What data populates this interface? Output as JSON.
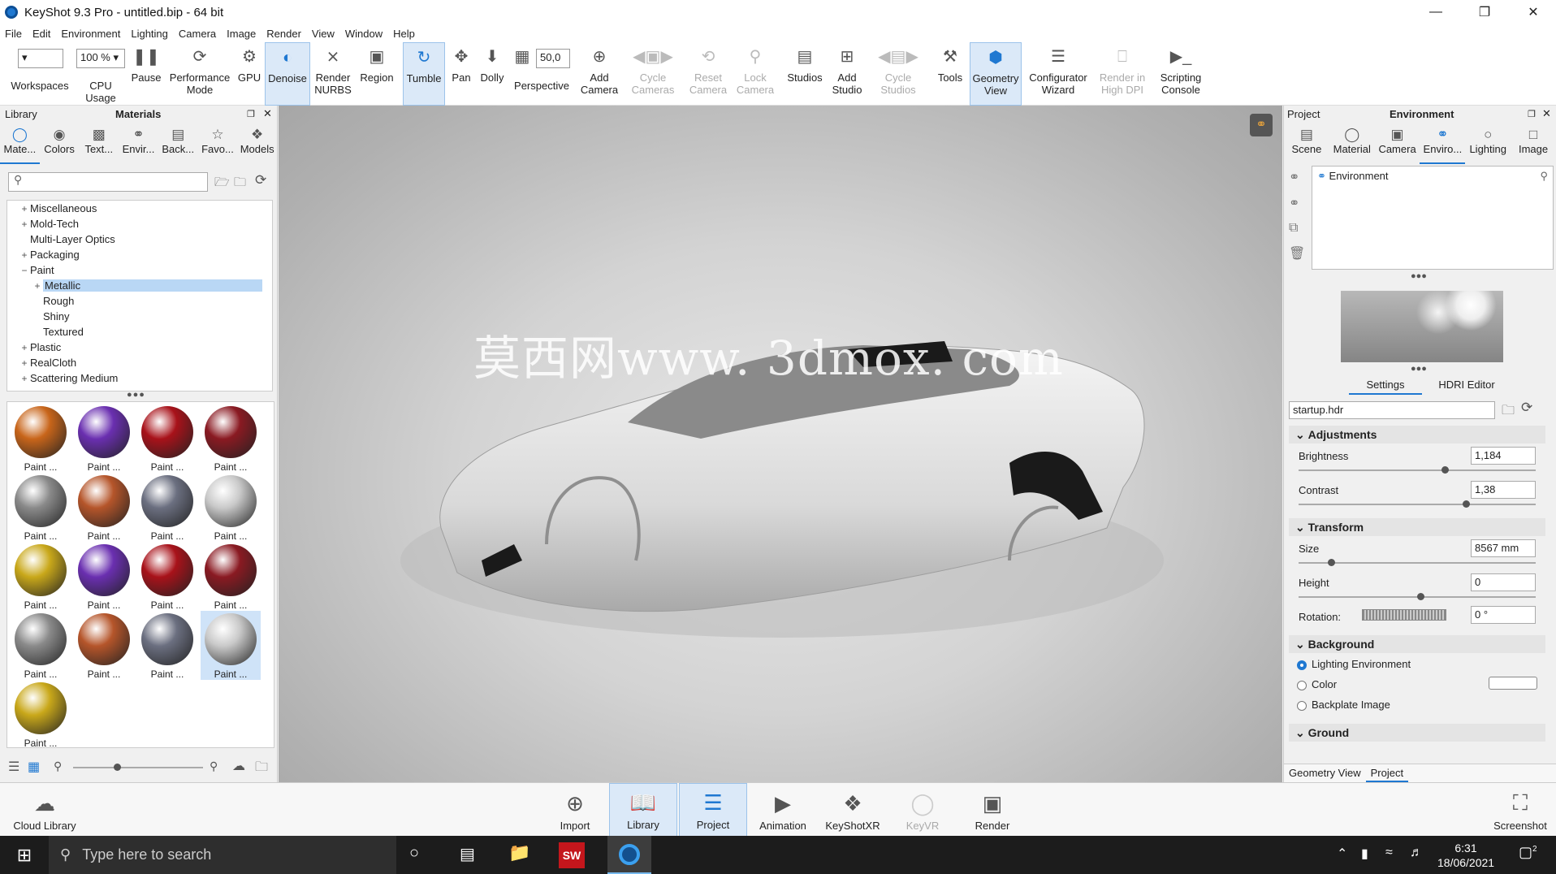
{
  "window": {
    "title": "KeyShot 9.3 Pro  - untitled.bip  - 64 bit"
  },
  "menu": [
    "File",
    "Edit",
    "Environment",
    "Lighting",
    "Camera",
    "Image",
    "Render",
    "View",
    "Window",
    "Help"
  ],
  "toolbar": {
    "zoom_value": "100 %",
    "focal_value": "50,0",
    "items": [
      {
        "label": "Workspaces",
        "icon": "workspaces-dropdown"
      },
      {
        "label": "CPU Usage",
        "icon": "cpu-usage-dropdown"
      },
      {
        "label": "Pause",
        "icon": "pause-icon"
      },
      {
        "label": "Performance Mode",
        "icon": "performance-icon"
      },
      {
        "label": "GPU",
        "icon": "gpu-icon"
      },
      {
        "label": "Denoise",
        "icon": "denoise-icon"
      },
      {
        "label": "Render NURBS",
        "icon": "nurbs-icon"
      },
      {
        "label": "Region",
        "icon": "region-icon"
      },
      {
        "label": "Tumble",
        "icon": "tumble-icon"
      },
      {
        "label": "Pan",
        "icon": "pan-icon"
      },
      {
        "label": "Dolly",
        "icon": "dolly-icon"
      },
      {
        "label": "Perspective",
        "icon": "perspective-icon"
      },
      {
        "label": "Add Camera",
        "icon": "add-camera-icon"
      },
      {
        "label": "Cycle Cameras",
        "icon": "cycle-cameras-icon"
      },
      {
        "label": "Reset Camera",
        "icon": "reset-camera-icon"
      },
      {
        "label": "Lock Camera",
        "icon": "lock-camera-icon"
      },
      {
        "label": "Studios",
        "icon": "studios-icon"
      },
      {
        "label": "Add Studio",
        "icon": "add-studio-icon"
      },
      {
        "label": "Cycle Studios",
        "icon": "cycle-studios-icon"
      },
      {
        "label": "Tools",
        "icon": "tools-icon"
      },
      {
        "label": "Geometry View",
        "icon": "geometry-view-icon"
      },
      {
        "label": "Configurator Wizard",
        "icon": "configurator-icon"
      },
      {
        "label": "Render in High DPI",
        "icon": "high-dpi-icon"
      },
      {
        "label": "Scripting Console",
        "icon": "scripting-console-icon"
      }
    ]
  },
  "library": {
    "header_left": "Library",
    "header_title": "Materials",
    "tabs": [
      "Mate...",
      "Colors",
      "Text...",
      "Envir...",
      "Back...",
      "Favo...",
      "Models"
    ],
    "tree": [
      {
        "label": "Miscellaneous",
        "exp": "+"
      },
      {
        "label": "Mold-Tech",
        "exp": "+"
      },
      {
        "label": "Multi-Layer Optics",
        "exp": ""
      },
      {
        "label": "Packaging",
        "exp": "+"
      },
      {
        "label": "Paint",
        "exp": "−"
      },
      {
        "label": "Metallic",
        "exp": "+",
        "indent": 1,
        "selected": true
      },
      {
        "label": "Rough",
        "exp": "",
        "indent": 1
      },
      {
        "label": "Shiny",
        "exp": "",
        "indent": 1
      },
      {
        "label": "Textured",
        "exp": "",
        "indent": 1
      },
      {
        "label": "Plastic",
        "exp": "+"
      },
      {
        "label": "RealCloth",
        "exp": "+"
      },
      {
        "label": "Scattering Medium",
        "exp": "+"
      }
    ],
    "thumb_label": "Paint ...",
    "thumbs": [
      "#c8651a",
      "#6a2fb0",
      "#a8121a",
      "#8a1a22",
      "#8a8a8a",
      "#b5552a",
      "#6b6f80",
      "#c9c9c9",
      "#c9a81a",
      "#6a2fb0",
      "#a8121a",
      "#8a1a22",
      "#8a8a8a",
      "#b5552a",
      "#6b6f80",
      "#c9c9c9",
      "#c9a81a"
    ]
  },
  "viewport": {
    "watermark": "莫西网www. 3dmox. com"
  },
  "project": {
    "header_left": "Project",
    "header_title": "Environment",
    "tabs": [
      "Scene",
      "Material",
      "Camera",
      "Enviro...",
      "Lighting",
      "Image"
    ],
    "env_item": "Environment",
    "subtabs": [
      "Settings",
      "HDRI Editor"
    ],
    "hdr_file": "startup.hdr",
    "adjustments": {
      "title": "Adjustments",
      "brightness_label": "Brightness",
      "brightness": "1,184",
      "contrast_label": "Contrast",
      "contrast": "1,38"
    },
    "transform": {
      "title": "Transform",
      "size_label": "Size",
      "size": "8567 mm",
      "height_label": "Height",
      "height": "0",
      "rotation_label": "Rotation:",
      "rotation": "0 °"
    },
    "background": {
      "title": "Background",
      "opt1": "Lighting Environment",
      "opt2": "Color",
      "opt3": "Backplate Image"
    },
    "ground": {
      "title": "Ground"
    },
    "bottom_tabs": [
      "Geometry View",
      "Project"
    ]
  },
  "bottom": {
    "cloud": "Cloud Library",
    "items": [
      "Import",
      "Library",
      "Project",
      "Animation",
      "KeyShotXR",
      "KeyVR",
      "Render"
    ],
    "screenshot": "Screenshot"
  },
  "taskbar": {
    "search": "Type here to search",
    "time": "6:31",
    "date": "18/06/2021",
    "notif": "2"
  }
}
